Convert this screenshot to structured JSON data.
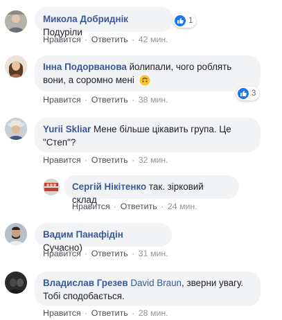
{
  "colors": {
    "author": "#385898",
    "bubble": "#f2f3f5",
    "like": "#1877f2",
    "meta": "#90949c"
  },
  "comments": [
    {
      "author": "Микола Добриднік",
      "text": "Подуріли",
      "like": "Нравится",
      "reply": "Ответить",
      "time": "42 мин.",
      "reactions": "1"
    },
    {
      "author": "Інна Подорванова",
      "text_line1": "йолипали, чого роблять",
      "text_line2": "вони, а соромно мені",
      "emoji": "upside-down-face-icon",
      "like": "Нравится",
      "reply": "Ответить",
      "time": "38 мин.",
      "reactions": "3"
    },
    {
      "author": "Yurii Skliar",
      "text_line1": "Мене більше цікавить група. Це",
      "text_line2": "\"Степ\"?",
      "like": "Нравится",
      "reply": "Ответить",
      "time": "32 мин."
    },
    {
      "author": "Сергій Нікітенко",
      "text": "так. зірковий склад",
      "like": "Нравится",
      "reply": "Ответить",
      "time": "24 мин."
    },
    {
      "author": "Вадим Панафідін",
      "text": "Сучасно)",
      "like": "Нравится",
      "reply": "Ответить",
      "time": "31 мин."
    },
    {
      "author": "Владислав Грезев",
      "mention": "David Braun",
      "text_line1": ", зверни увагу.",
      "text_line2": "Тобі сподобається.",
      "like": "Нравится",
      "reply": "Ответить",
      "time": "28 мин."
    }
  ],
  "separator": "·"
}
